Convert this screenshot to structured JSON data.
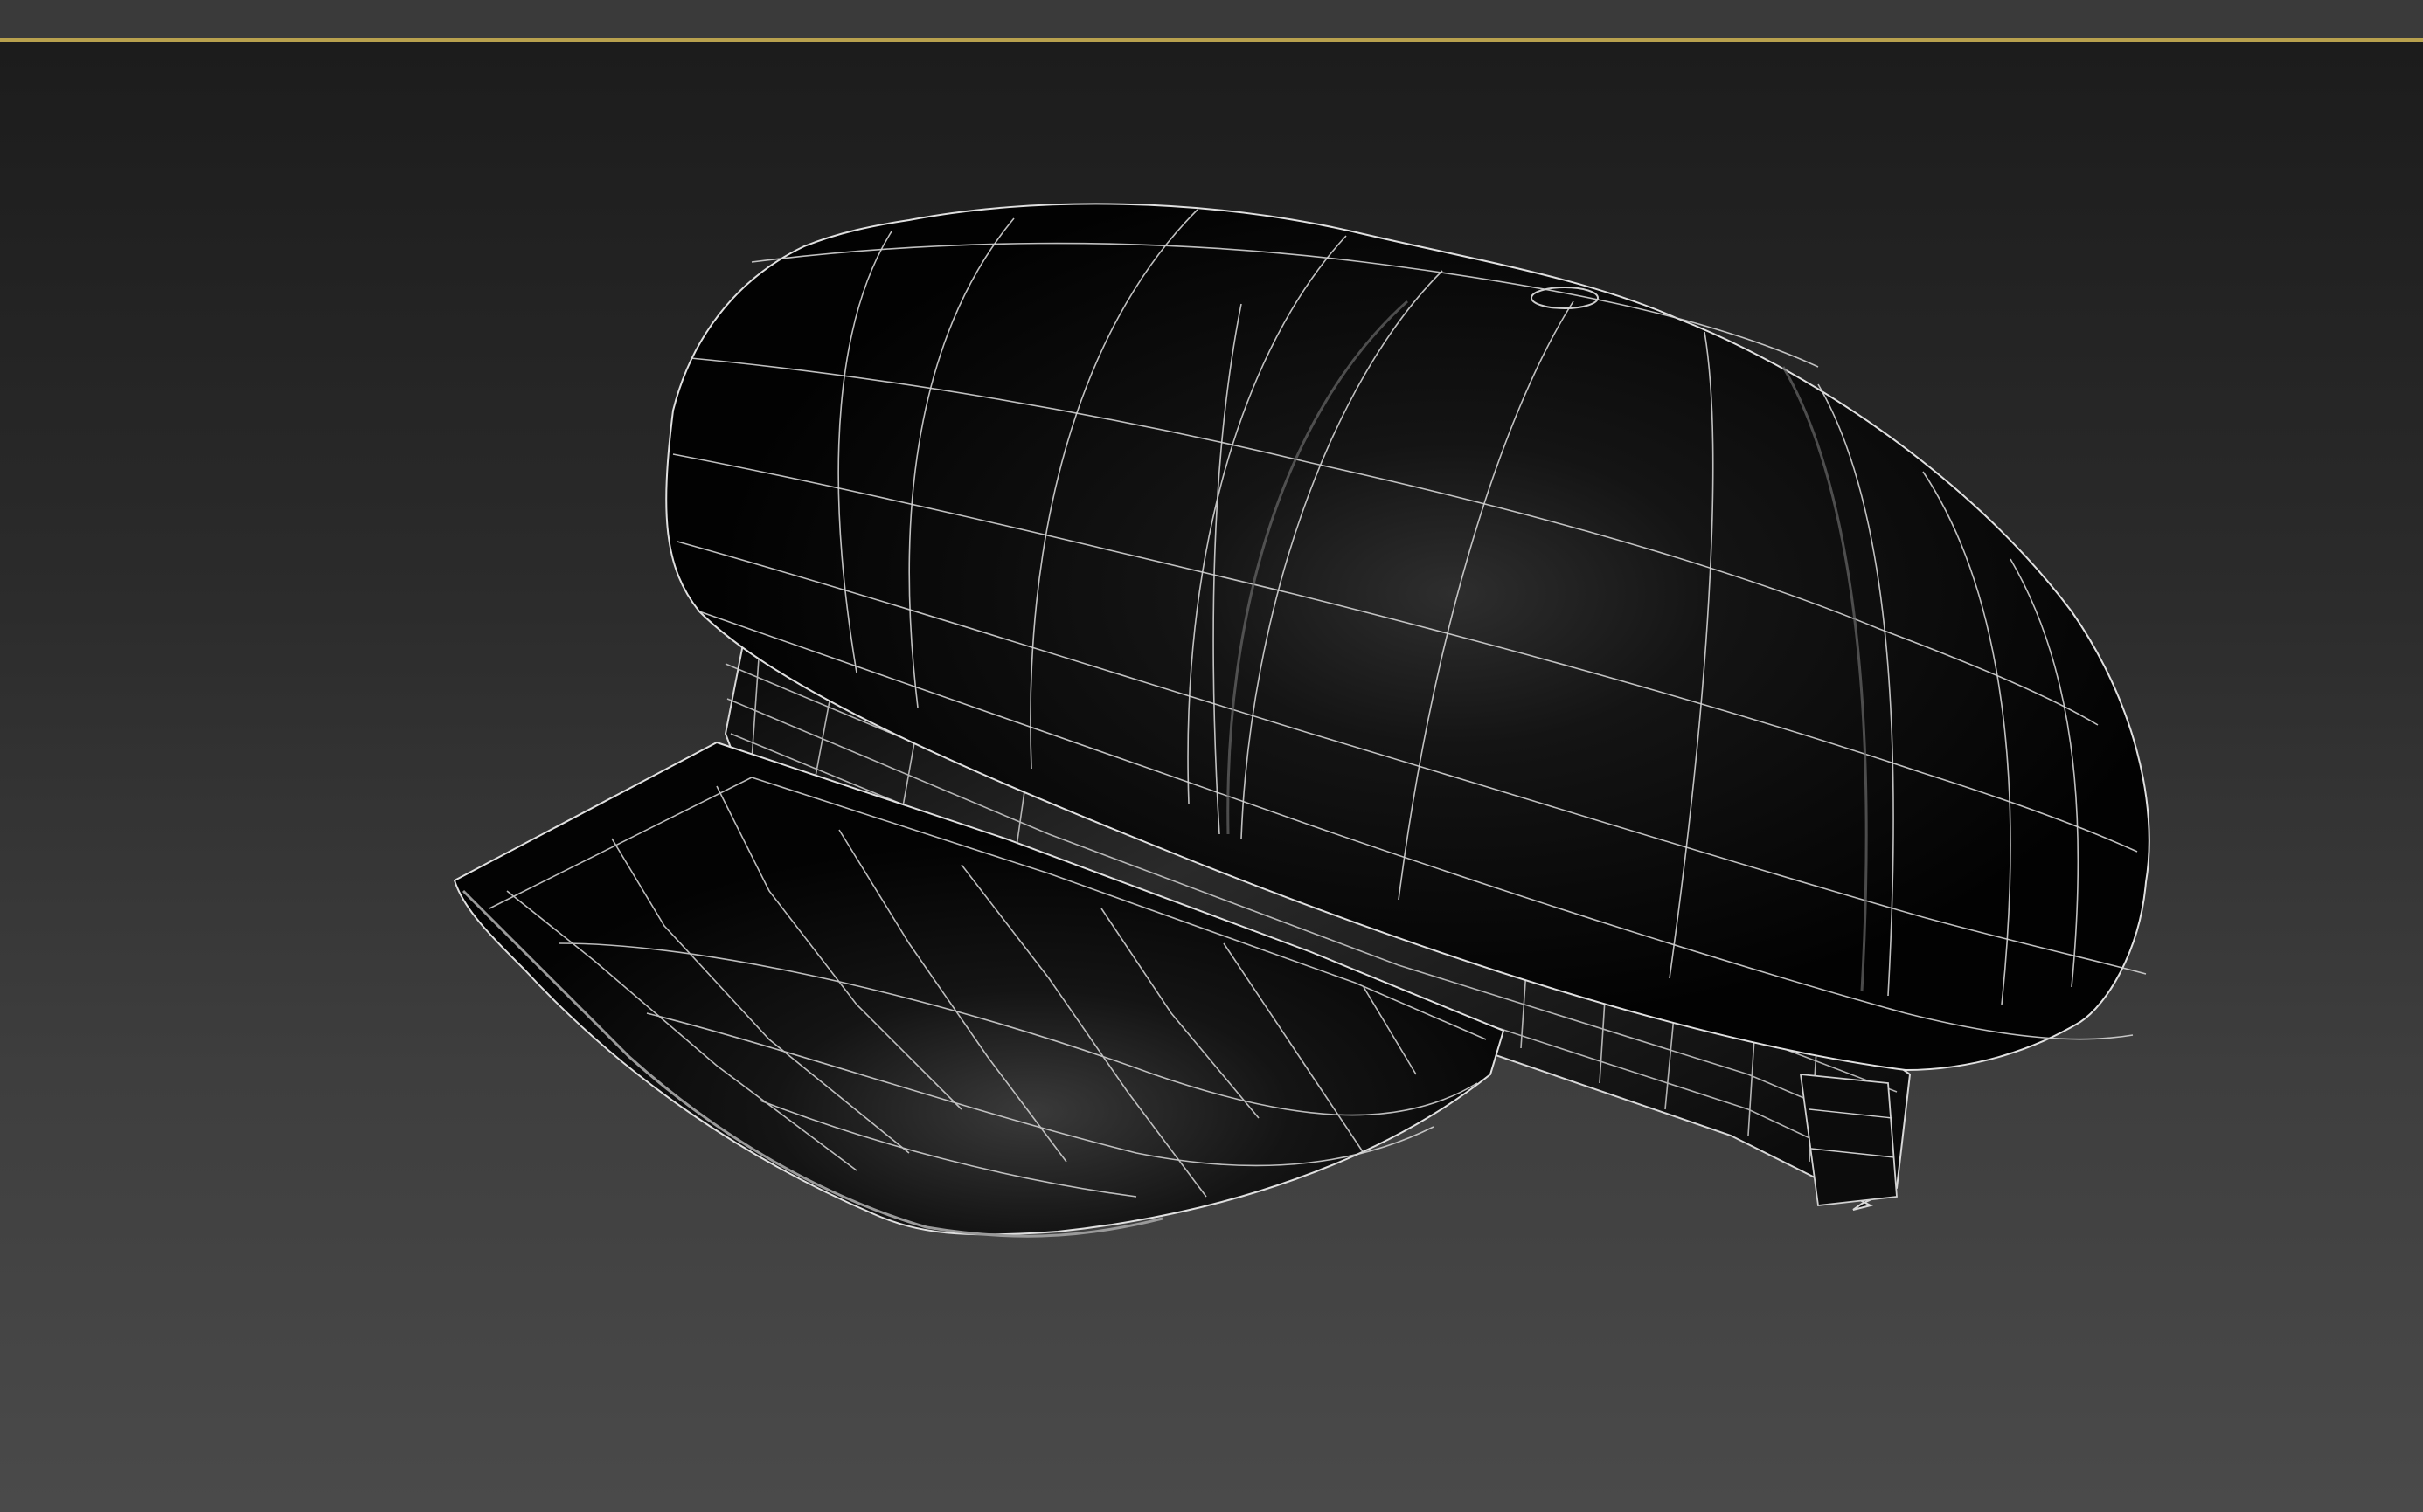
{
  "viewport": {
    "object": "cap",
    "render_mode": "shaded-with-wireframe",
    "colors": {
      "active_border": "#b8a14e",
      "background_top": "#1c1c1c",
      "background_bottom": "#4a4a4a",
      "mesh_fill": "#050505",
      "wire": "#d8d8d8"
    }
  }
}
